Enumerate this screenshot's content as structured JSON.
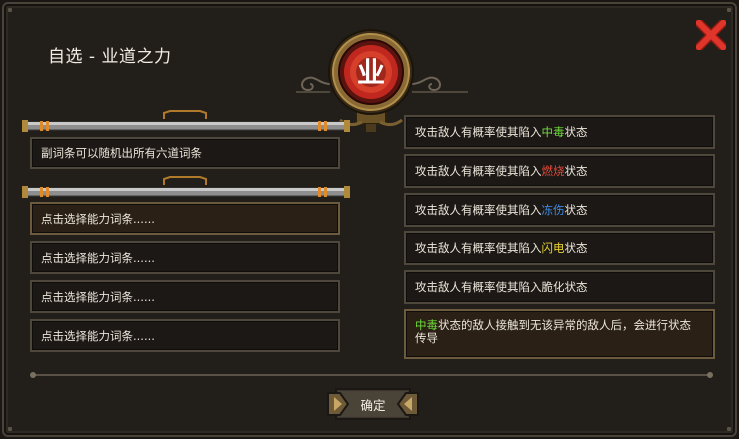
{
  "dialog": {
    "title": "自选 - 业道之力",
    "emblem_glyph": "业",
    "close_icon": "close-x-icon",
    "accent_red": "#e0352b"
  },
  "left": {
    "info_text": "副词条可以随机出所有六道词条",
    "options": [
      "点击选择能力词条......",
      "点击选择能力词条......",
      "点击选择能力词条......",
      "点击选择能力词条......"
    ]
  },
  "right": {
    "effects": [
      {
        "prefix": "攻击敌人有概率使其陷入",
        "keyword": "中毒",
        "suffix": "状态",
        "keyword_color": "green"
      },
      {
        "prefix": "攻击敌人有概率使其陷入",
        "keyword": "燃烧",
        "suffix": "状态",
        "keyword_color": "red"
      },
      {
        "prefix": "攻击敌人有概率使其陷入",
        "keyword": "冻伤",
        "suffix": "状态",
        "keyword_color": "blue"
      },
      {
        "prefix": "攻击敌人有概率使其陷入",
        "keyword": "闪电",
        "suffix": "状态",
        "keyword_color": "yellow"
      },
      {
        "prefix": "攻击敌人有概率使其陷入脆化状态",
        "keyword": "",
        "suffix": "",
        "keyword_color": ""
      }
    ],
    "special": {
      "keyword": "中毒",
      "line1": "状态的敌人接触到无该异常的敌人后，会进行状态",
      "line2": "传导"
    }
  },
  "footer": {
    "confirm_label": "确定"
  }
}
